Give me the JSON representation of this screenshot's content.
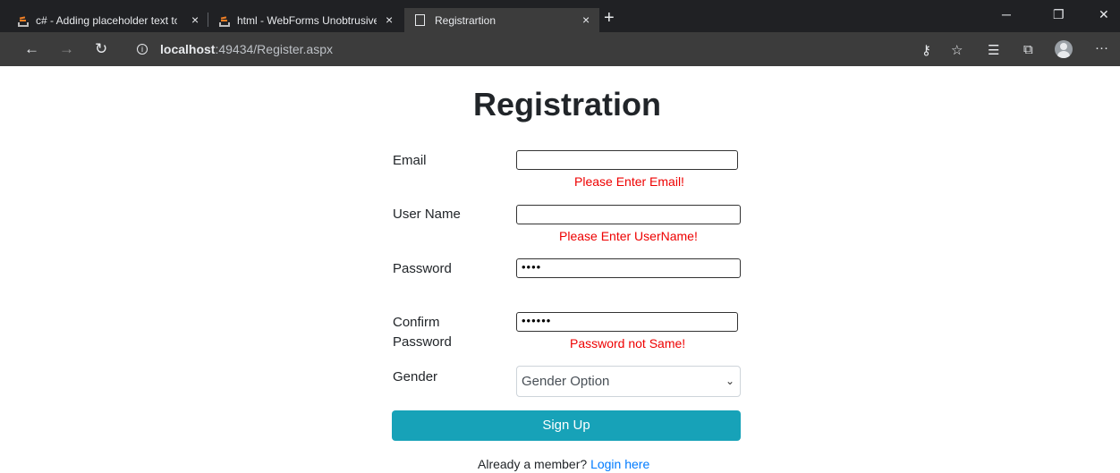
{
  "browser": {
    "tabs": [
      {
        "title": "c# - Adding placeholder text to t",
        "icon": "stackoverflow-icon",
        "active": false
      },
      {
        "title": "html - WebForms UnobtrusiveVa",
        "icon": "stackoverflow-icon",
        "active": false
      },
      {
        "title": "Registrartion",
        "icon": "page-icon",
        "active": true
      }
    ],
    "close_glyph": "×",
    "new_tab_glyph": "+",
    "window": {
      "minimize": "─",
      "restore": "❐",
      "close": "✕"
    },
    "address": {
      "host": "localhost",
      "rest": ":49434/Register.aspx"
    },
    "toolbar_icons": [
      "key-icon",
      "favorite-star-icon",
      "favorites-list-icon",
      "collections-icon",
      "profile-avatar-icon",
      "more-menu-icon"
    ]
  },
  "form": {
    "title": "Registration",
    "email_label": "Email",
    "email_error": "Please Enter Email!",
    "username_label": "User Name",
    "username_error": "Please Enter UserName!",
    "password_label": "Password",
    "password_value": "••••",
    "confirm_label_line1": "Confirm",
    "confirm_label_line2": "Password",
    "confirm_value": "••••••",
    "confirm_error": "Password not Same!",
    "gender_label": "Gender",
    "gender_selected": "Gender Option",
    "signup_label": "Sign Up",
    "already_text": "Already a member?",
    "login_link": "Login here"
  },
  "colors": {
    "accent": "#17a2b8",
    "error": "#e00000",
    "link": "#007bff",
    "chrome_dark": "#202124",
    "chrome_bar": "#3c3c3c"
  }
}
